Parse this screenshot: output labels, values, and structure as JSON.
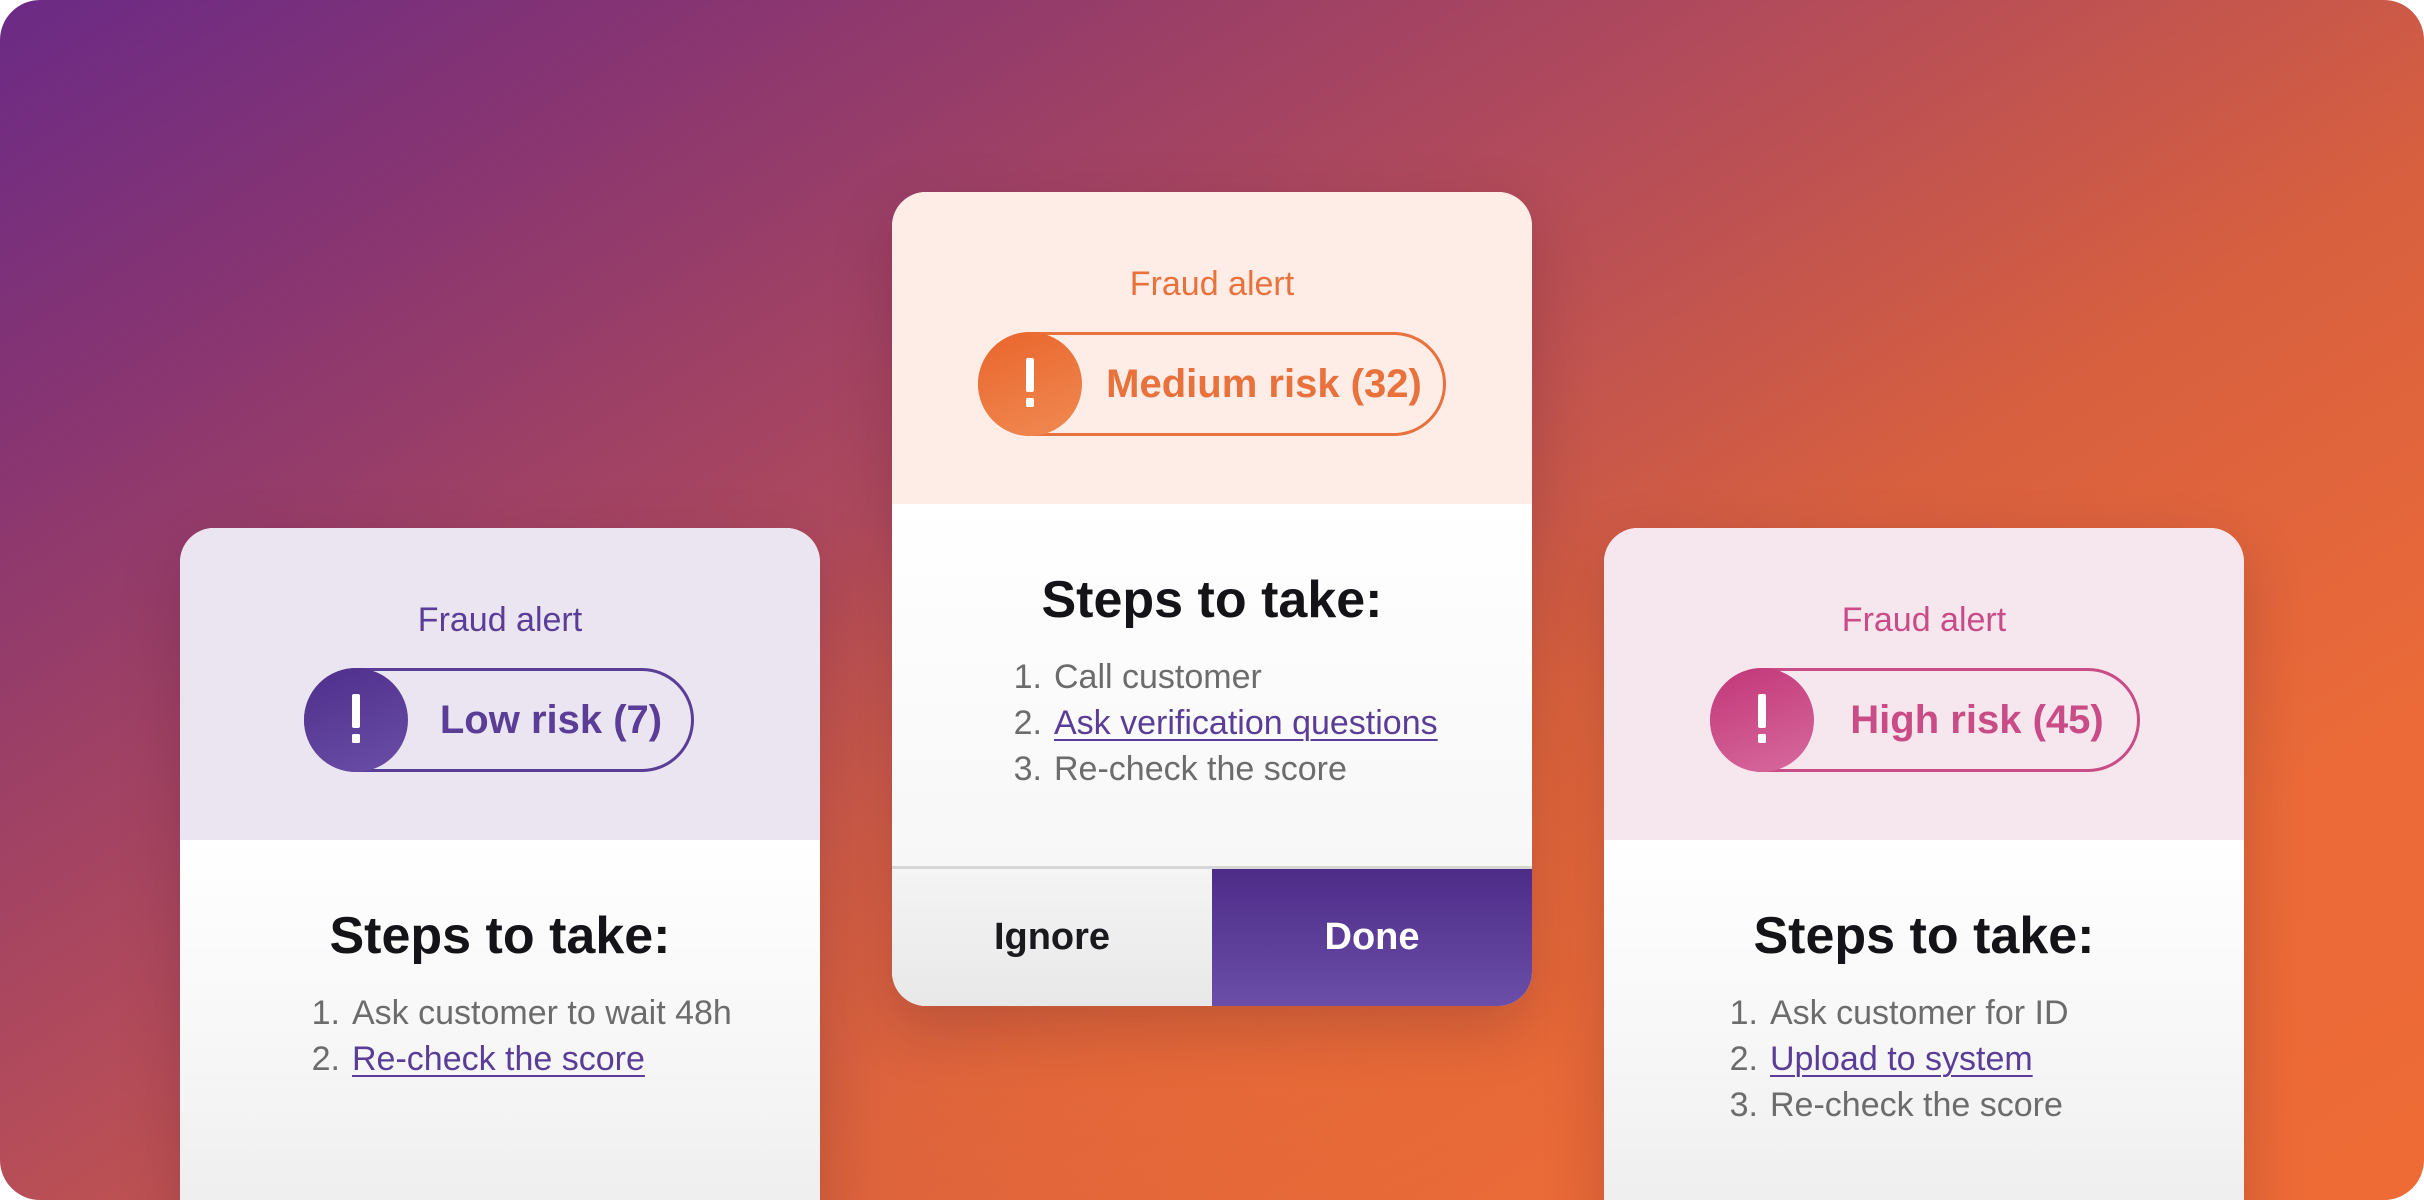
{
  "cards": [
    {
      "id": "low",
      "alert_title": "Fraud alert",
      "risk_label": "Low risk (7)",
      "risk_score": 7,
      "accent_color": "#5a3d97",
      "icon": "exclamation-icon",
      "steps_heading": "Steps to take:",
      "steps": [
        {
          "num": "1.",
          "text": "Ask customer to wait 48h",
          "link": false
        },
        {
          "num": "2.",
          "text": "Re-check the score",
          "link": true
        }
      ]
    },
    {
      "id": "medium",
      "alert_title": "Fraud alert",
      "risk_label": "Medium risk (32)",
      "risk_score": 32,
      "accent_color": "#e8713c",
      "icon": "exclamation-icon",
      "steps_heading": "Steps to take:",
      "steps": [
        {
          "num": "1.",
          "text": "Call customer",
          "link": false
        },
        {
          "num": "2.",
          "text": "Ask verification questions",
          "link": true
        },
        {
          "num": "3.",
          "text": "Re-check the score",
          "link": false
        }
      ],
      "buttons": {
        "ignore_label": "Ignore",
        "done_label": "Done"
      }
    },
    {
      "id": "high",
      "alert_title": "Fraud alert",
      "risk_label": "High risk (45)",
      "risk_score": 45,
      "accent_color": "#c94c86",
      "icon": "exclamation-icon",
      "steps_heading": "Steps to take:",
      "steps": [
        {
          "num": "1.",
          "text": "Ask customer for ID",
          "link": false
        },
        {
          "num": "2.",
          "text": "Upload to system",
          "link": true
        },
        {
          "num": "3.",
          "text": "Re-check the score",
          "link": false
        }
      ]
    }
  ],
  "colors": {
    "background_start": "#6b2a86",
    "background_end": "#ee6b36",
    "done_button": "#5a3d97",
    "heading_text": "#141418",
    "step_text": "#6c6c6c"
  }
}
